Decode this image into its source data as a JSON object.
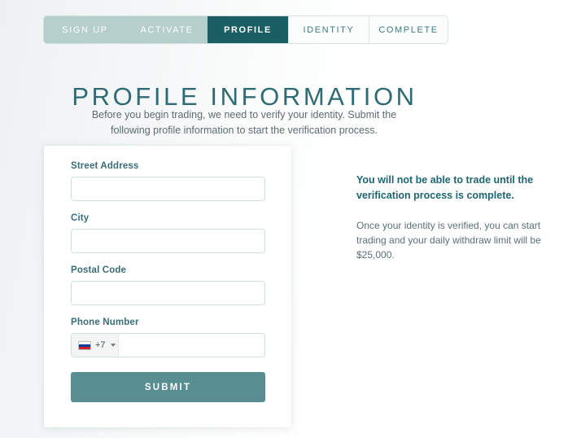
{
  "stepper": {
    "steps": [
      {
        "label": "SIGN UP",
        "state": "done"
      },
      {
        "label": "ACTIVATE",
        "state": "done"
      },
      {
        "label": "PROFILE",
        "state": "active"
      },
      {
        "label": "IDENTITY",
        "state": "todo"
      },
      {
        "label": "COMPLETE",
        "state": "todo"
      }
    ]
  },
  "header": {
    "title": "PROFILE INFORMATION",
    "subtitle": "Before you begin trading, we need to verify your identity. Submit the following profile information to start the verification process."
  },
  "form": {
    "fields": [
      {
        "label": "Street Address",
        "value": "",
        "placeholder": ""
      },
      {
        "label": "City",
        "value": "",
        "placeholder": ""
      },
      {
        "label": "Postal Code",
        "value": "",
        "placeholder": ""
      },
      {
        "label": "Phone Number",
        "value": "",
        "placeholder": ""
      }
    ],
    "phone": {
      "country_flag": "russia-flag-icon",
      "dial_code": "+7",
      "dropdown_icon": "chevron-down-icon",
      "value": "",
      "placeholder": ""
    },
    "submit_label": "SUBMIT"
  },
  "info": {
    "heading": "You will not be able to trade until the verification process is complete.",
    "body": "Once your identity is verified, you can start trading and your daily withdraw limit will be $25,000."
  },
  "colors": {
    "active_tab": "#195f63",
    "done_tab": "#b6cfcd",
    "todo_tab_text": "#3d7b80",
    "title": "#2e6b75",
    "label": "#3a6d78",
    "submit": "#588d91",
    "info_heading": "#1d6570",
    "input_border": "#cfe1e0"
  }
}
